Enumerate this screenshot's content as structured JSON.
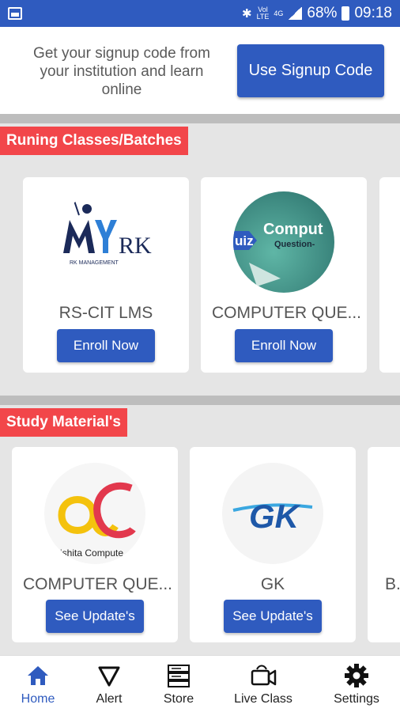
{
  "status_bar": {
    "network_top": "Vol",
    "network_bottom": "LTE",
    "signal_label": "4G",
    "battery": "68%",
    "time": "09:18"
  },
  "signup": {
    "message": "Get your signup code from your institution and learn online",
    "button_label": "Use Signup Code"
  },
  "running": {
    "title": "Runing Classes/Batches",
    "cards": [
      {
        "name": "RS-CIT LMS",
        "button": "Enroll Now",
        "logo_text": "RK",
        "logo_sub": "RK MANAGEMENT"
      },
      {
        "name": "COMPUTER QUE...",
        "button": "Enroll Now",
        "logo_text": "Comput",
        "logo_sub": "Question-",
        "logo_badge": "uiz"
      }
    ]
  },
  "study": {
    "title": "Study Material's",
    "cards": [
      {
        "name": "COMPUTER QUE...",
        "button": "See Update's",
        "logo_caption": "ishita Compute"
      },
      {
        "name": "GK",
        "button": "See Update's",
        "logo_text": "GK"
      },
      {
        "name": "B.",
        "button": ""
      }
    ]
  },
  "nav": {
    "items": [
      {
        "label": "Home",
        "icon": "home-icon"
      },
      {
        "label": "Alert",
        "icon": "alert-icon"
      },
      {
        "label": "Store",
        "icon": "store-icon"
      },
      {
        "label": "Live Class",
        "icon": "video-camera-icon"
      },
      {
        "label": "Settings",
        "icon": "gear-icon"
      }
    ]
  },
  "colors": {
    "primary": "#2f5bbf",
    "section_header": "#f2464a",
    "background": "#e5e5e5"
  }
}
